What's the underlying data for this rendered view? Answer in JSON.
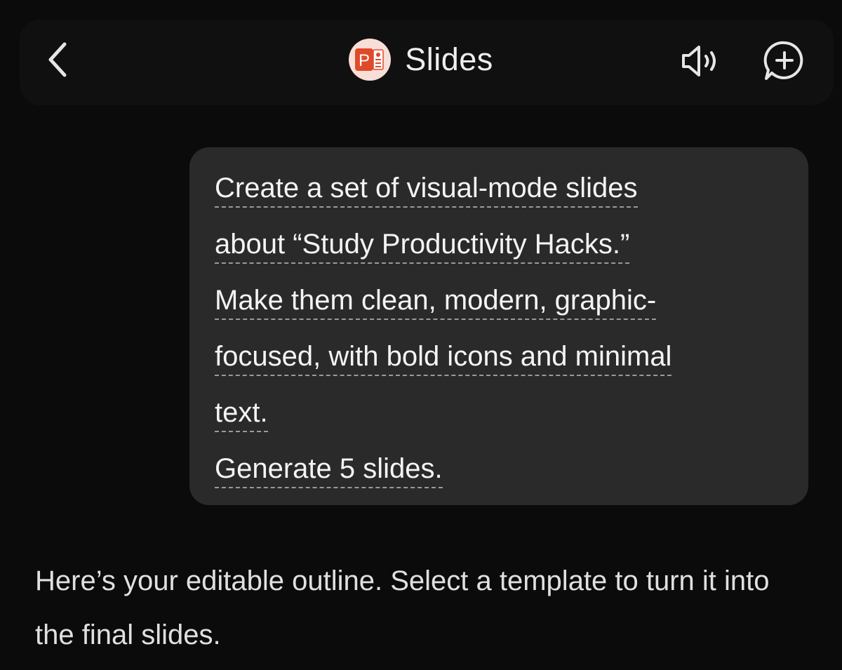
{
  "header": {
    "title": "Slides",
    "back_icon": "chevron-left-icon",
    "app_icon": "powerpoint-icon",
    "app_icon_letter": "P",
    "speaker_icon": "speaker-icon",
    "new_chat_icon": "add-chat-icon"
  },
  "user_message": {
    "lines": [
      "Create a set of visual-mode slides",
      "about “Study Productivity Hacks.”",
      "Make them clean, modern, graphic-",
      "focused, with bold icons and minimal",
      "text.",
      "Generate 5 slides."
    ]
  },
  "assistant_message": {
    "text": "Here’s your editable outline. Select a template to turn it into the final slides."
  },
  "colors": {
    "background": "#0b0b0b",
    "bubble": "#2a2a2a",
    "app_icon_bg": "#f8ded6",
    "app_icon_accent": "#e04a2a"
  }
}
